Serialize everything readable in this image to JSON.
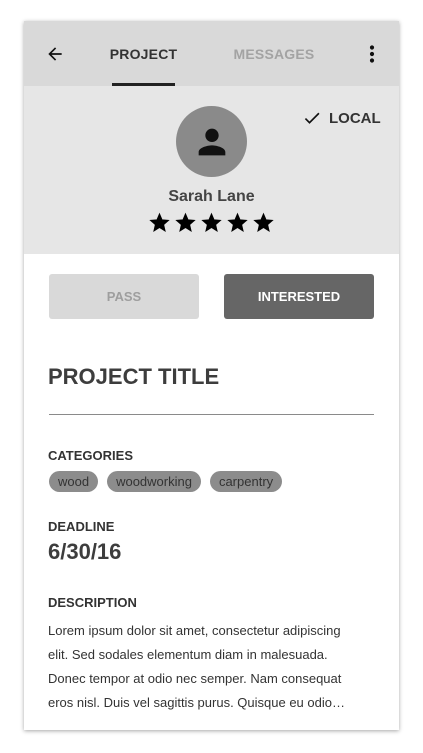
{
  "colors": {
    "appbar_bg": "#d9d9d9",
    "profile_bg": "#e6e6e6",
    "active_tab": "#333333",
    "inactive_tab": "#a3a3a3",
    "pass_bg": "#d9d9d9",
    "interested_bg": "#666666",
    "chip_bg": "#8c8c8c"
  },
  "appbar": {
    "back_icon": "arrow-left-icon",
    "tabs": [
      {
        "label": "PROJECT",
        "active": true
      },
      {
        "label": "MESSAGES",
        "active": false
      }
    ],
    "overflow_icon": "more-vert-icon"
  },
  "profile": {
    "local_icon": "check-icon",
    "local_label": "LOCAL",
    "avatar_icon": "person-icon",
    "name": "Sarah Lane",
    "rating": 5,
    "rating_max": 5
  },
  "actions": {
    "pass_label": "PASS",
    "interested_label": "INTERESTED"
  },
  "project": {
    "title": "PROJECT TITLE",
    "categories_label": "CATEGORIES",
    "categories": [
      "wood",
      "woodworking",
      "carpentry"
    ],
    "deadline_label": "DEADLINE",
    "deadline": "6/30/16",
    "description_label": "DESCRIPTION",
    "description_lines": [
      "Lorem ipsum dolor sit amet, consectetur adipiscing",
      "elit. Sed sodales elementum diam in malesuada.",
      "Donec tempor at odio nec semper. Nam consequat",
      "eros nisl. Duis vel sagittis purus. Quisque eu odio…"
    ]
  }
}
